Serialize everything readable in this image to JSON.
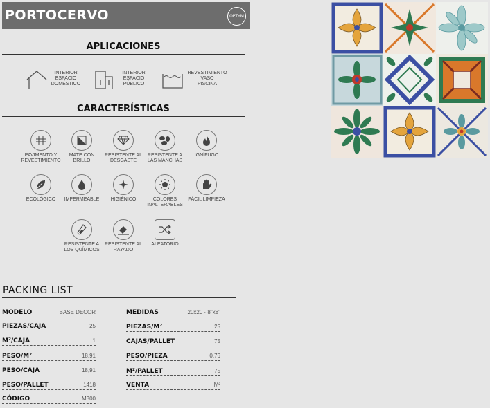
{
  "header": {
    "title": "PORTOCERVO",
    "brand": "OPTYM"
  },
  "aplicaciones": {
    "heading": "APLICACIONES",
    "items": [
      {
        "label": "INTERIOR\nESPACIO\nDOMÉSTICO",
        "icon": "house-icon"
      },
      {
        "label": "INTERIOR\nESPACIO\nPÚBLICO",
        "icon": "building-icon"
      },
      {
        "label": "REVESTIMIENTO\nVASO\nPISCINA",
        "icon": "pool-icon"
      }
    ]
  },
  "caracteristicas": {
    "heading": "CARACTERÍSTICAS",
    "items": [
      {
        "label": "PAVIMENTO Y\nREVESTIMIENTO",
        "icon": "grid-icon"
      },
      {
        "label": "MATE CON\nBRILLO",
        "icon": "matte-gloss-icon"
      },
      {
        "label": "RESISTENTE AL\nDESGASTE",
        "icon": "diamond-icon"
      },
      {
        "label": "RESISTENTE A\nLAS MANCHAS",
        "icon": "stain-icon"
      },
      {
        "label": "IGNÍFUGO",
        "icon": "flame-icon"
      },
      {
        "label": "ECOLÓGICO",
        "icon": "leaf-icon"
      },
      {
        "label": "IMPERMEABLE",
        "icon": "drop-icon"
      },
      {
        "label": "HIGIÉNICO",
        "icon": "sparkle-icon"
      },
      {
        "label": "COLORES\nINALTERABLES",
        "icon": "sun-icon"
      },
      {
        "label": "FÁCIL LIMPIEZA",
        "icon": "hand-icon"
      },
      {
        "label": "RESISTENTE A\nLOS QUÍMICOS",
        "icon": "flask-icon"
      },
      {
        "label": "RESISTENTE AL\nRAYADO",
        "icon": "scratch-icon"
      },
      {
        "label": "ALEATORIO",
        "icon": "shuffle-icon"
      }
    ]
  },
  "packing": {
    "heading": "PACKING LIST",
    "left": [
      {
        "key": "MODELO",
        "value": "BASE DECOR"
      },
      {
        "key": "PIEZAS/CAJA",
        "value": "25"
      },
      {
        "key": "M²/CAJA",
        "value": "1"
      },
      {
        "key": "PESO/M²",
        "value": "18,91"
      },
      {
        "key": "PESO/CAJA",
        "value": "18,91"
      },
      {
        "key": "PESO/PALLET",
        "value": "1418"
      },
      {
        "key": "CÓDIGO",
        "value": "M300"
      }
    ],
    "right": [
      {
        "key": "MEDIDAS",
        "value": "20x20 · 8\"x8\""
      },
      {
        "key": "PIEZAS/M²",
        "value": "25"
      },
      {
        "key": "CAJAS/PALLET",
        "value": "75"
      },
      {
        "key": "PESO/PIEZA",
        "value": "0,76"
      },
      {
        "key": "M²/PALLET",
        "value": "75"
      },
      {
        "key": "VENTA",
        "value": "M²"
      }
    ]
  },
  "colors": {
    "header_bg": "#6d6d6d",
    "page_bg": "#e6e6e6",
    "tile_blue": "#3b4fa3",
    "tile_green": "#2f7a52",
    "tile_orange": "#d9782b",
    "tile_teal": "#5a9aa0"
  }
}
